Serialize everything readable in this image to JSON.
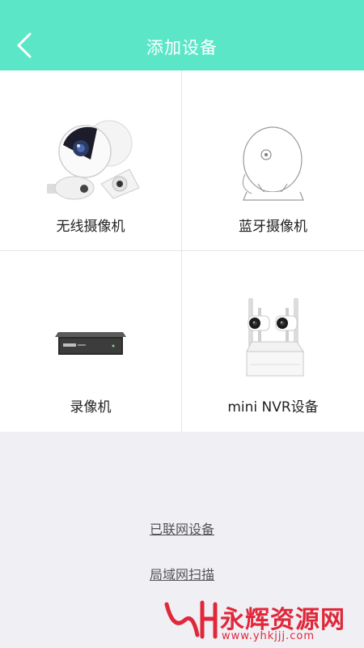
{
  "header": {
    "title": "添加设备",
    "back_icon": "chevron-left-icon",
    "bg_color": "#5ce6c8"
  },
  "devices": [
    {
      "label": "无线摄像机",
      "icon": "wireless-camera-icon"
    },
    {
      "label": "蓝牙摄像机",
      "icon": "bluetooth-camera-icon"
    },
    {
      "label": "录像机",
      "icon": "recorder-icon"
    },
    {
      "label": "mini NVR设备",
      "icon": "mini-nvr-icon"
    }
  ],
  "links": {
    "connected": "已联网设备",
    "lan_scan": "局域网扫描"
  },
  "watermark": {
    "text": "永辉资源网",
    "url": "www.yhkjjj.com",
    "color": "#e0283a"
  }
}
